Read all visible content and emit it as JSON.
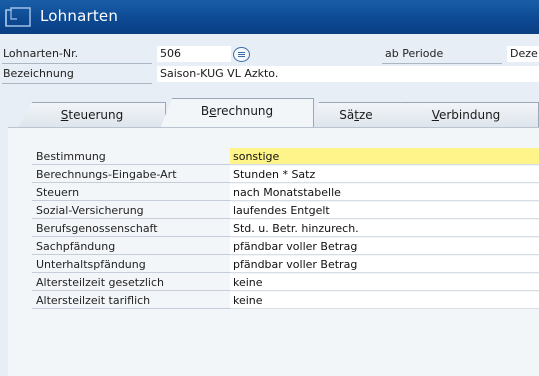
{
  "window": {
    "title": "Lohnarten",
    "icon": "form-window-icon",
    "title_bar_color": "#0c4892"
  },
  "header": {
    "lohnart_nr_label": "Lohnarten-Nr.",
    "lohnart_nr_value": "506",
    "bezeichnung_label": "Bezeichnung",
    "bezeichnung_value": "Saison-KUG VL Azkto.",
    "ab_periode_label": "ab Periode",
    "ab_periode_value": "Deze"
  },
  "tabs": [
    {
      "label": "Steuerung",
      "mnemonic": "S",
      "rest": "teuerung",
      "active": false
    },
    {
      "label": "Berechnung",
      "mnemonic": "e",
      "pre": "B",
      "rest": "rechnung",
      "active": true
    },
    {
      "label": "Sätze",
      "pre": "Sä",
      "mnemonic": "t",
      "rest": "ze",
      "active": false
    },
    {
      "label": "Verbindung",
      "mnemonic": "V",
      "rest": "erbindung",
      "active": false
    }
  ],
  "fields": [
    {
      "label": "Bestimmung",
      "value": "sonstige",
      "highlight": true
    },
    {
      "label": "Berechnungs-Eingabe-Art",
      "value": "Stunden * Satz"
    },
    {
      "label": "Steuern",
      "value": "nach Monatstabelle"
    },
    {
      "label": "Sozial-Versicherung",
      "value": "laufendes Entgelt"
    },
    {
      "label": "Berufsgenossenschaft",
      "value": "Std. u. Betr. hinzurech."
    },
    {
      "label": "Sachpfändung",
      "value": "pfändbar voller Betrag"
    },
    {
      "label": "Unterhaltspfändung",
      "value": "pfändbar voller Betrag"
    },
    {
      "label": "Altersteilzeit gesetzlich",
      "value": "keine"
    },
    {
      "label": "Altersteilzeit tariflich",
      "value": "keine"
    }
  ],
  "colors": {
    "highlight": "#fff489",
    "panel": "#f3f6f9",
    "background": "#e8eef5"
  }
}
